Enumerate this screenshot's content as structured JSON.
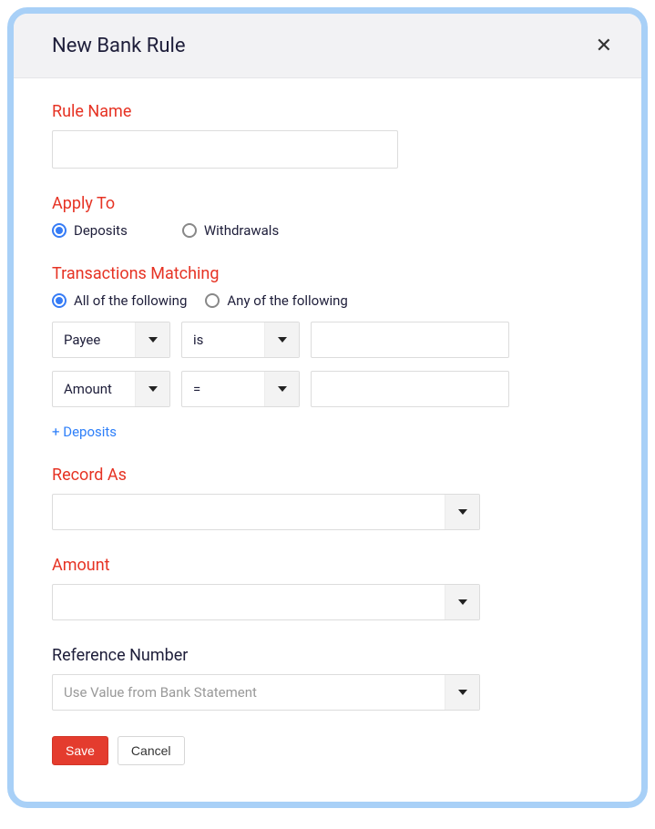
{
  "header": {
    "title": "New Bank Rule"
  },
  "rule_name": {
    "label": "Rule Name",
    "value": ""
  },
  "apply_to": {
    "label": "Apply To",
    "options": {
      "deposits": "Deposits",
      "withdrawals": "Withdrawals"
    },
    "selected": "deposits"
  },
  "transactions": {
    "label": "Transactions Matching",
    "match_mode": {
      "all": "All of the following",
      "any": "Any of the following"
    },
    "selected_mode": "all",
    "rows": [
      {
        "field": "Payee",
        "operator": "is",
        "value": ""
      },
      {
        "field": "Amount",
        "operator": "=",
        "value": ""
      }
    ],
    "add_link": "+ Deposits"
  },
  "record_as": {
    "label": "Record As",
    "value": ""
  },
  "amount": {
    "label": "Amount",
    "value": ""
  },
  "reference": {
    "label": "Reference Number",
    "value": "Use Value from Bank Statement"
  },
  "buttons": {
    "save": "Save",
    "cancel": "Cancel"
  }
}
